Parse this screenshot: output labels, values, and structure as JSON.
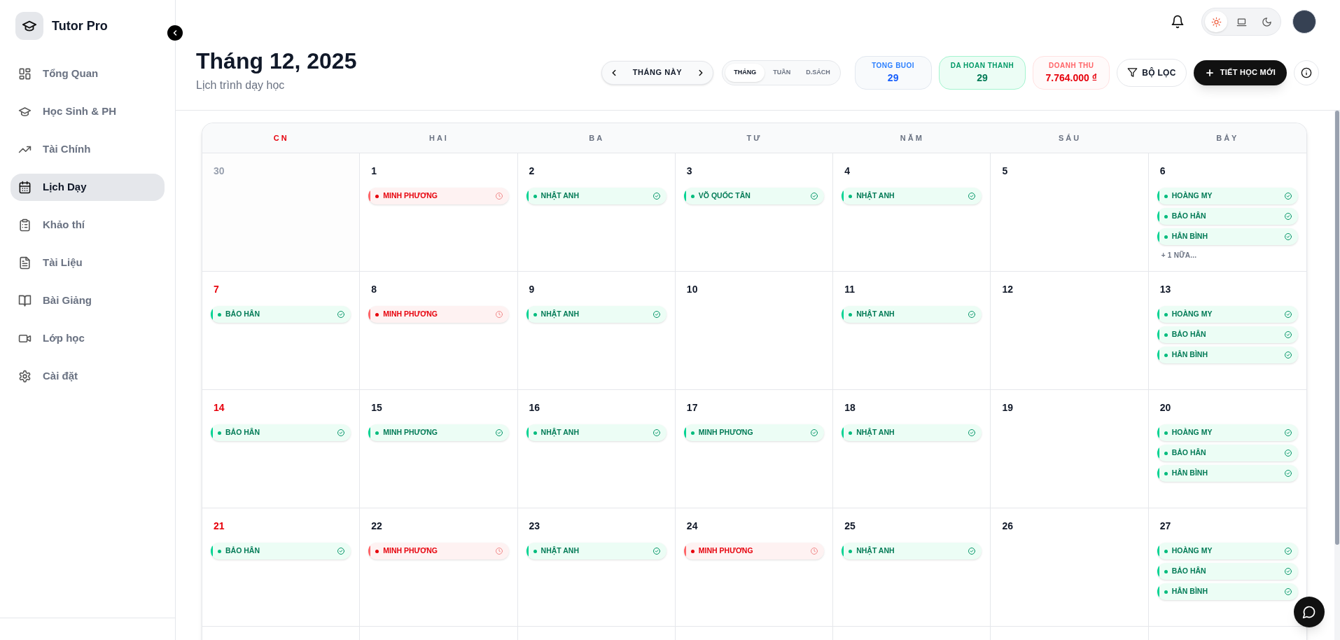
{
  "app": {
    "name": "Tutor Pro"
  },
  "sidebar": {
    "items": [
      {
        "label": "Tổng Quan",
        "kind": "grid",
        "selected": false
      },
      {
        "label": "Học Sinh & PH",
        "kind": "cap",
        "selected": false
      },
      {
        "label": "Tài Chính",
        "kind": "trend",
        "selected": false
      },
      {
        "label": "Lịch Dạy",
        "kind": "calendar",
        "selected": true
      },
      {
        "label": "Khảo thí",
        "kind": "clipboard",
        "selected": false
      },
      {
        "label": "Tài Liệu",
        "kind": "file",
        "selected": false
      },
      {
        "label": "Bài Giảng",
        "kind": "book",
        "selected": false
      },
      {
        "label": "Lớp học",
        "kind": "video",
        "selected": false
      },
      {
        "label": "Cài đặt",
        "kind": "gear",
        "selected": false
      }
    ]
  },
  "theme_toggle": [
    {
      "kind": "sun",
      "selected": true
    },
    {
      "kind": "laptop",
      "selected": false
    },
    {
      "kind": "moon",
      "selected": false
    }
  ],
  "header": {
    "title": "Tháng 12, 2025",
    "subtitle": "Lịch trình dạy học"
  },
  "month_nav": {
    "label": "THÁNG NÀY"
  },
  "view_tabs": [
    {
      "label": "THÁNG",
      "selected": true
    },
    {
      "label": "TUẦN",
      "selected": false
    },
    {
      "label": "D.SÁCH",
      "selected": false
    }
  ],
  "stats": [
    {
      "label": "TONG BUOI",
      "value": "29",
      "kind": "blue"
    },
    {
      "label": "DA HOAN THANH",
      "value": "29",
      "kind": "green"
    },
    {
      "label": "DOANH THU",
      "value": "7.764.000 ₫",
      "kind": "red"
    }
  ],
  "filter_button": "BỘ LỌC",
  "new_button": "TIẾT HỌC MỚI",
  "calendar": {
    "columns": [
      {
        "label": "CN",
        "highlight": true
      },
      {
        "label": "HAI",
        "highlight": false
      },
      {
        "label": "BA",
        "highlight": false
      },
      {
        "label": "TƯ",
        "highlight": false
      },
      {
        "label": "NĂM",
        "highlight": false
      },
      {
        "label": "SÁU",
        "highlight": false
      },
      {
        "label": "BẢY",
        "highlight": false
      }
    ],
    "weeks": [
      {
        "days": [
          {
            "day": "30",
            "muted": true
          },
          {
            "day": "1",
            "muted": false,
            "events": [
              {
                "name": "MINH PHƯƠNG",
                "kind": "pending"
              }
            ]
          },
          {
            "day": "2",
            "muted": false,
            "events": [
              {
                "name": "NHẬT ANH",
                "kind": "done"
              }
            ]
          },
          {
            "day": "3",
            "muted": false,
            "events": [
              {
                "name": "VÕ QUỐC TÂN",
                "kind": "done"
              }
            ]
          },
          {
            "day": "4",
            "muted": false,
            "events": [
              {
                "name": "NHẬT ANH",
                "kind": "done"
              }
            ]
          },
          {
            "day": "5",
            "muted": false
          },
          {
            "day": "6",
            "muted": false,
            "events": [
              {
                "name": "HOÀNG MY",
                "kind": "done"
              },
              {
                "name": "BẢO HÂN",
                "kind": "done"
              },
              {
                "name": "HÂN BÌNH",
                "kind": "done"
              }
            ],
            "more": "+ 1 NỮA..."
          }
        ]
      },
      {
        "days": [
          {
            "day": "7",
            "muted": false,
            "events": [
              {
                "name": "BẢO HÂN",
                "kind": "done"
              }
            ]
          },
          {
            "day": "8",
            "muted": false,
            "events": [
              {
                "name": "MINH PHƯƠNG",
                "kind": "pending"
              }
            ]
          },
          {
            "day": "9",
            "muted": false,
            "events": [
              {
                "name": "NHẬT ANH",
                "kind": "done"
              }
            ]
          },
          {
            "day": "10",
            "muted": false
          },
          {
            "day": "11",
            "muted": false,
            "events": [
              {
                "name": "NHẬT ANH",
                "kind": "done"
              }
            ]
          },
          {
            "day": "12",
            "muted": false
          },
          {
            "day": "13",
            "muted": false,
            "events": [
              {
                "name": "HOÀNG MY",
                "kind": "done"
              },
              {
                "name": "BẢO HÂN",
                "kind": "done"
              },
              {
                "name": "HÂN BÌNH",
                "kind": "done"
              }
            ]
          }
        ]
      },
      {
        "days": [
          {
            "day": "14",
            "muted": false,
            "events": [
              {
                "name": "BẢO HÂN",
                "kind": "done"
              }
            ]
          },
          {
            "day": "15",
            "muted": false,
            "events": [
              {
                "name": "MINH PHƯƠNG",
                "kind": "done"
              }
            ]
          },
          {
            "day": "16",
            "muted": false,
            "events": [
              {
                "name": "NHẬT ANH",
                "kind": "done"
              }
            ]
          },
          {
            "day": "17",
            "muted": false,
            "events": [
              {
                "name": "MINH PHƯƠNG",
                "kind": "done"
              }
            ]
          },
          {
            "day": "18",
            "muted": false,
            "events": [
              {
                "name": "NHẬT ANH",
                "kind": "done"
              }
            ]
          },
          {
            "day": "19",
            "muted": false
          },
          {
            "day": "20",
            "muted": false,
            "events": [
              {
                "name": "HOÀNG MY",
                "kind": "done"
              },
              {
                "name": "BẢO HÂN",
                "kind": "done"
              },
              {
                "name": "HÂN BÌNH",
                "kind": "done"
              }
            ]
          }
        ]
      },
      {
        "days": [
          {
            "day": "21",
            "muted": false,
            "events": [
              {
                "name": "BẢO HÂN",
                "kind": "done"
              }
            ]
          },
          {
            "day": "22",
            "muted": false,
            "events": [
              {
                "name": "MINH PHƯƠNG",
                "kind": "pending"
              }
            ]
          },
          {
            "day": "23",
            "muted": false,
            "events": [
              {
                "name": "NHẬT ANH",
                "kind": "done"
              }
            ]
          },
          {
            "day": "24",
            "muted": false,
            "events": [
              {
                "name": "MINH PHƯƠNG",
                "kind": "pending"
              }
            ]
          },
          {
            "day": "25",
            "muted": false,
            "events": [
              {
                "name": "NHẬT ANH",
                "kind": "done"
              }
            ]
          },
          {
            "day": "26",
            "muted": false
          },
          {
            "day": "27",
            "muted": false,
            "events": [
              {
                "name": "HOÀNG MY",
                "kind": "done"
              },
              {
                "name": "BẢO HÂN",
                "kind": "done"
              },
              {
                "name": "HÂN BÌNH",
                "kind": "done"
              }
            ]
          }
        ]
      }
    ]
  }
}
